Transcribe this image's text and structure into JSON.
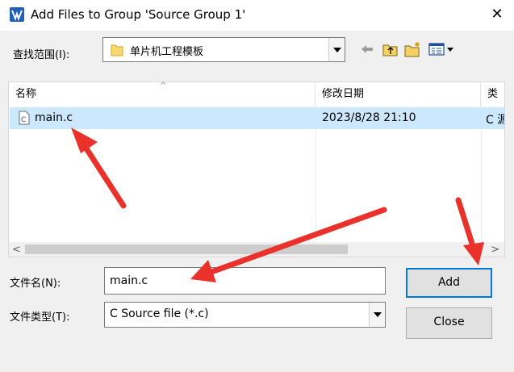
{
  "window": {
    "title": "Add Files to Group 'Source Group 1'",
    "close_glyph": "✕",
    "app_icon": "keil-uvision-icon"
  },
  "lookin": {
    "label": "查找范围(I):",
    "value": "单片机工程模板",
    "icon": "folder-icon"
  },
  "toolbar": {
    "back_icon": "back-arrow-icon",
    "up_icon": "up-folder-icon",
    "new_folder_icon": "new-folder-icon",
    "view_icon": "view-menu-icon"
  },
  "filelist": {
    "columns": [
      "名称",
      "修改日期",
      "类"
    ],
    "sort_glyph": "^",
    "rows": [
      {
        "name": "main.c",
        "modified": "2023/8/28 21:10",
        "type": "C 源",
        "icon": "c-file-icon",
        "selected": true
      }
    ],
    "scroll_left": "<",
    "scroll_right": ">"
  },
  "filename": {
    "label": "文件名(N):",
    "value": "main.c"
  },
  "filetype": {
    "label": "文件类型(T):",
    "value": "C Source file (*.c)"
  },
  "buttons": {
    "add": "Add",
    "close": "Close"
  },
  "colors": {
    "selection": "#cce8ff",
    "accent": "#0078d7",
    "annotation_arrow": "#e8322b"
  }
}
